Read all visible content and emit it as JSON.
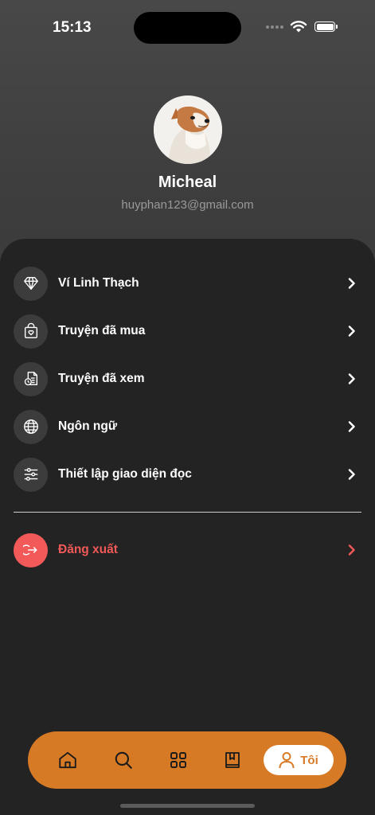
{
  "status_bar": {
    "time": "15:13"
  },
  "profile": {
    "name": "Micheal",
    "email": "huyphan123@gmail.com"
  },
  "menu": [
    {
      "label": "Ví Linh Thạch",
      "icon": "diamond-icon"
    },
    {
      "label": "Truyện đã mua",
      "icon": "shopping-bag-icon"
    },
    {
      "label": "Truyện đã xem",
      "icon": "history-document-icon"
    },
    {
      "label": "Ngôn ngữ",
      "icon": "globe-icon"
    },
    {
      "label": "Thiết lập giao diện đọc",
      "icon": "sliders-icon"
    }
  ],
  "logout": {
    "label": "Đăng xuất",
    "icon": "logout-icon"
  },
  "tabbar": {
    "tabs": [
      {
        "icon": "home-icon"
      },
      {
        "icon": "search-icon"
      },
      {
        "icon": "grid-icon"
      },
      {
        "icon": "bookmark-book-icon"
      }
    ],
    "active": {
      "label": "Tôi",
      "icon": "user-icon"
    }
  },
  "colors": {
    "accent": "#d77a26",
    "danger": "#f25959",
    "sheet": "#232323"
  }
}
